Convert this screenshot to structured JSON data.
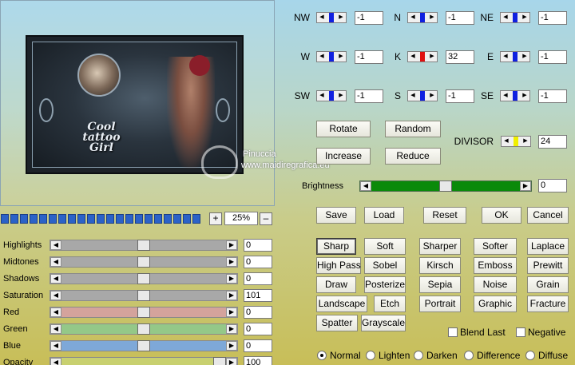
{
  "preview": {
    "title_art": "Cool tattoo Girl"
  },
  "watermark": {
    "line1": "Pinuccia",
    "line2": "www.maidiregrafica.eu"
  },
  "zoom": {
    "plus": "+",
    "minus": "–",
    "value": "25%"
  },
  "adjustments": [
    {
      "label": "Highlights",
      "value": "0",
      "color": "#a8a8a8",
      "level": 0.5
    },
    {
      "label": "Midtones",
      "value": "0",
      "color": "#a8a8a8",
      "level": 0.5
    },
    {
      "label": "Shadows",
      "value": "0",
      "color": "#a8a8a8",
      "level": 0.5
    },
    {
      "label": "Saturation",
      "value": "101",
      "color": "#a8a8a8",
      "level": 0.5
    },
    {
      "label": "Red",
      "value": "0",
      "color": "#d4a39c",
      "level": 0.5
    },
    {
      "label": "Green",
      "value": "0",
      "color": "#94c888",
      "level": 0.5
    },
    {
      "label": "Blue",
      "value": "0",
      "color": "#7ea8d8",
      "level": 0.5
    },
    {
      "label": "Opacity",
      "value": "100",
      "color": "#c8d070",
      "level": 1.0
    }
  ],
  "matrix": [
    {
      "label": "NW",
      "value": "-1",
      "marker": "#1020e0"
    },
    {
      "label": "N",
      "value": "-1",
      "marker": "#1020e0"
    },
    {
      "label": "NE",
      "value": "-1",
      "marker": "#1020e0"
    },
    {
      "label": "W",
      "value": "-1",
      "marker": "#1020e0"
    },
    {
      "label": "K",
      "value": "32",
      "marker": "#e01010"
    },
    {
      "label": "E",
      "value": "-1",
      "marker": "#1020e0"
    },
    {
      "label": "SW",
      "value": "-1",
      "marker": "#1020e0"
    },
    {
      "label": "S",
      "value": "-1",
      "marker": "#1020e0"
    },
    {
      "label": "SE",
      "value": "-1",
      "marker": "#1020e0"
    }
  ],
  "divisor": {
    "label": "DIVISOR",
    "value": "24",
    "marker": "#f0f000"
  },
  "matrix_buttons": {
    "rotate": "Rotate",
    "random": "Random",
    "increase": "Increase",
    "reduce": "Reduce"
  },
  "brightness": {
    "label": "Brightness",
    "value": "0",
    "level": 0.5
  },
  "actions": {
    "save": "Save",
    "load": "Load",
    "reset": "Reset",
    "ok": "OK",
    "cancel": "Cancel"
  },
  "presets": [
    [
      "Sharp",
      "Soft",
      "Sharper",
      "Softer",
      "Laplace"
    ],
    [
      "High Pass",
      "Sobel",
      "Kirsch",
      "Emboss",
      "Prewitt"
    ],
    [
      "Draw",
      "Posterize",
      "Sepia",
      "Noise",
      "Grain"
    ],
    [
      "Landscape",
      "Etch",
      "Portrait",
      "Graphic",
      "Fracture"
    ],
    [
      "Spatter",
      "Grayscale"
    ]
  ],
  "selected_preset": "Sharp",
  "options": {
    "blend_last": "Blend Last",
    "negative": "Negative"
  },
  "blend_modes": [
    "Normal",
    "Lighten",
    "Darken",
    "Difference",
    "Diffuse"
  ],
  "selected_blend": "Normal",
  "progress_segments": 21
}
